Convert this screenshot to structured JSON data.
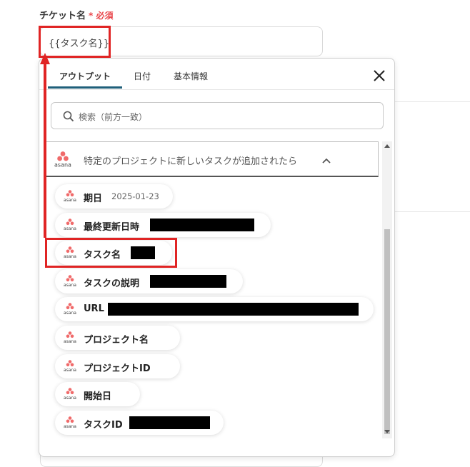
{
  "field": {
    "label": "チケット名",
    "required_mark": "*",
    "required_text": "必須",
    "value": "{{タスク名}}"
  },
  "popup": {
    "tabs": [
      {
        "label": "アウトプット",
        "active": true
      },
      {
        "label": "日付",
        "active": false
      },
      {
        "label": "基本情報",
        "active": false
      }
    ],
    "search_placeholder": "検索（前方一致）",
    "section": {
      "logo_text": "asana",
      "title": "特定のプロジェクトに新しいタスクが追加されたら"
    },
    "items": [
      {
        "label": "期日",
        "value": "2025-01-23",
        "redacted": false
      },
      {
        "label": "最終更新日時",
        "value": "",
        "redacted": true
      },
      {
        "label": "タスク名",
        "value": "",
        "redacted": true
      },
      {
        "label": "タスクの説明",
        "value": "",
        "redacted": true
      },
      {
        "label": "URL",
        "value": "",
        "redacted": true
      },
      {
        "label": "プロジェクト名",
        "value": "",
        "redacted": false
      },
      {
        "label": "プロジェクトID",
        "value": "",
        "redacted": false
      },
      {
        "label": "開始日",
        "value": "",
        "redacted": false
      },
      {
        "label": "タスクID",
        "value": "",
        "redacted": true
      }
    ]
  },
  "colors": {
    "required": "#e9484d",
    "highlight": "#e02424",
    "tab_active": "#1f5f7a",
    "asana": "#f06a6a"
  },
  "icons": [
    "close-icon",
    "search-icon",
    "asana-logo-icon",
    "chevron-up-icon"
  ]
}
